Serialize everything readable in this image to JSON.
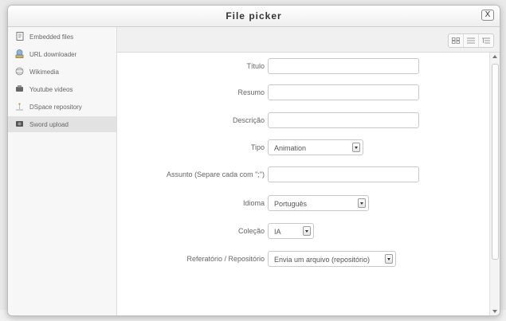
{
  "dialog": {
    "title": "File picker",
    "close_label": "X"
  },
  "sidebar": {
    "items": [
      {
        "label": "Embedded files",
        "icon": "embedded-files-icon"
      },
      {
        "label": "URL downloader",
        "icon": "url-downloader-icon"
      },
      {
        "label": "Wikimedia",
        "icon": "wikimedia-icon"
      },
      {
        "label": "Youtube videos",
        "icon": "youtube-icon"
      },
      {
        "label": "DSpace repository",
        "icon": "dspace-icon"
      },
      {
        "label": "Sword upload",
        "icon": "sword-icon",
        "active": true
      }
    ]
  },
  "toolbar": {
    "view_icons": [
      "icons-view-icon",
      "list-view-icon",
      "tree-view-icon"
    ]
  },
  "form": {
    "titulo_label": "Título",
    "resumo_label": "Resumo",
    "descricao_label": "Descrição",
    "tipo_label": "Tipo",
    "tipo_value": "Animation",
    "assunto_label": "Assunto (Separe cada com \";\")",
    "idioma_label": "Idioma",
    "idioma_value": "Português",
    "colecao_label": "Coleção",
    "colecao_value": "IA",
    "referatorio_label": "Referatório / Repositório",
    "referatorio_value": "Envia um arquivo (repositório)"
  }
}
